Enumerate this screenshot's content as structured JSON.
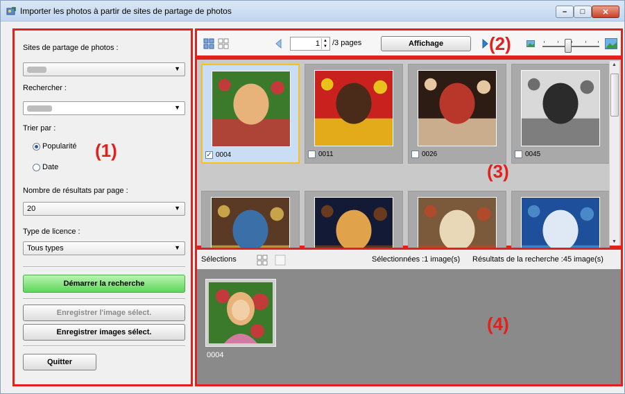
{
  "window": {
    "title": "Importer les photos à partir de sites de partage de photos",
    "min_glyph": "–",
    "max_glyph": "□",
    "close_glyph": "✕"
  },
  "panel1": {
    "number": "(1)",
    "sites_label": "Sites de partage de photos :",
    "search_label": "Rechercher :",
    "sort_label": "Trier par :",
    "sort_options": [
      {
        "label": "Popularité",
        "selected": true
      },
      {
        "label": "Date",
        "selected": false
      }
    ],
    "results_label": "Nombre de résultats par page :",
    "results_value": "20",
    "license_label": "Type de licence :",
    "license_value": "Tous types",
    "start_search": "Démarrer la recherche",
    "save_image": "Enregistrer l'image sélect.",
    "save_images": "Enregistrer images sélect.",
    "quit": "Quitter"
  },
  "panel2": {
    "number": "(2)",
    "page_value": "1",
    "pages_text": "/3 pages",
    "display_button": "Affichage"
  },
  "panel3": {
    "number": "(3)",
    "photos": [
      {
        "id": "0004",
        "checked": true,
        "selected": true,
        "colors": [
          "#3b7a2a",
          "#c33a3a",
          "#e8b37a"
        ]
      },
      {
        "id": "0011",
        "checked": false,
        "selected": false,
        "colors": [
          "#c8211e",
          "#e8c21a",
          "#4a2a18"
        ]
      },
      {
        "id": "0026",
        "checked": false,
        "selected": false,
        "colors": [
          "#2d1c14",
          "#e6c7a2",
          "#b8362a"
        ]
      },
      {
        "id": "0045",
        "checked": false,
        "selected": false,
        "colors": [
          "#d9d9d9",
          "#6d6d6d",
          "#2b2b2b"
        ]
      },
      {
        "id": "",
        "checked": false,
        "selected": false,
        "colors": [
          "#5a3a24",
          "#c7a44a",
          "#3a6fa8"
        ]
      },
      {
        "id": "",
        "checked": false,
        "selected": false,
        "colors": [
          "#121a36",
          "#6a3a1e",
          "#e0a24a"
        ]
      },
      {
        "id": "",
        "checked": false,
        "selected": false,
        "colors": [
          "#7a5a3a",
          "#b04a2a",
          "#e8d8b8"
        ]
      },
      {
        "id": "",
        "checked": false,
        "selected": false,
        "colors": [
          "#1d4f9a",
          "#4a88c8",
          "#dfe9f5"
        ]
      }
    ]
  },
  "panel4": {
    "number": "(4)",
    "selections_label": "Sélections",
    "selected_count": "Sélectionnées :1 image(s)",
    "results_count": "Résultats de la recherche :45 image(s)",
    "selected_photo": "0004"
  },
  "colors": {
    "frame_red": "#e2211c",
    "accent_green": "#5fd55a",
    "selection_border": "#f4c21a"
  }
}
